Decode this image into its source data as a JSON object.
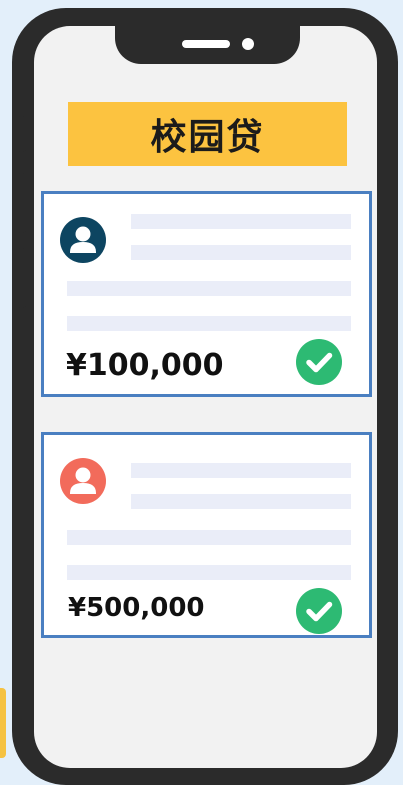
{
  "title": "校园贷",
  "cards": [
    {
      "amount": "¥100,000",
      "avatar_icon": "user-icon",
      "avatar_color": "#0d4561",
      "status_icon": "check-circle-icon",
      "status_color": "#2dba73"
    },
    {
      "amount": "¥500,000",
      "avatar_icon": "user-icon",
      "avatar_color": "#f26b5b",
      "status_icon": "check-circle-icon",
      "status_color": "#2dba73"
    }
  ],
  "colors": {
    "background": "#e3effa",
    "phone_body": "#2b2b2b",
    "screen": "#f2f2f2",
    "title_banner": "#fcc340",
    "card_border": "#4a7fc1",
    "placeholder_line": "#eaedf8"
  }
}
